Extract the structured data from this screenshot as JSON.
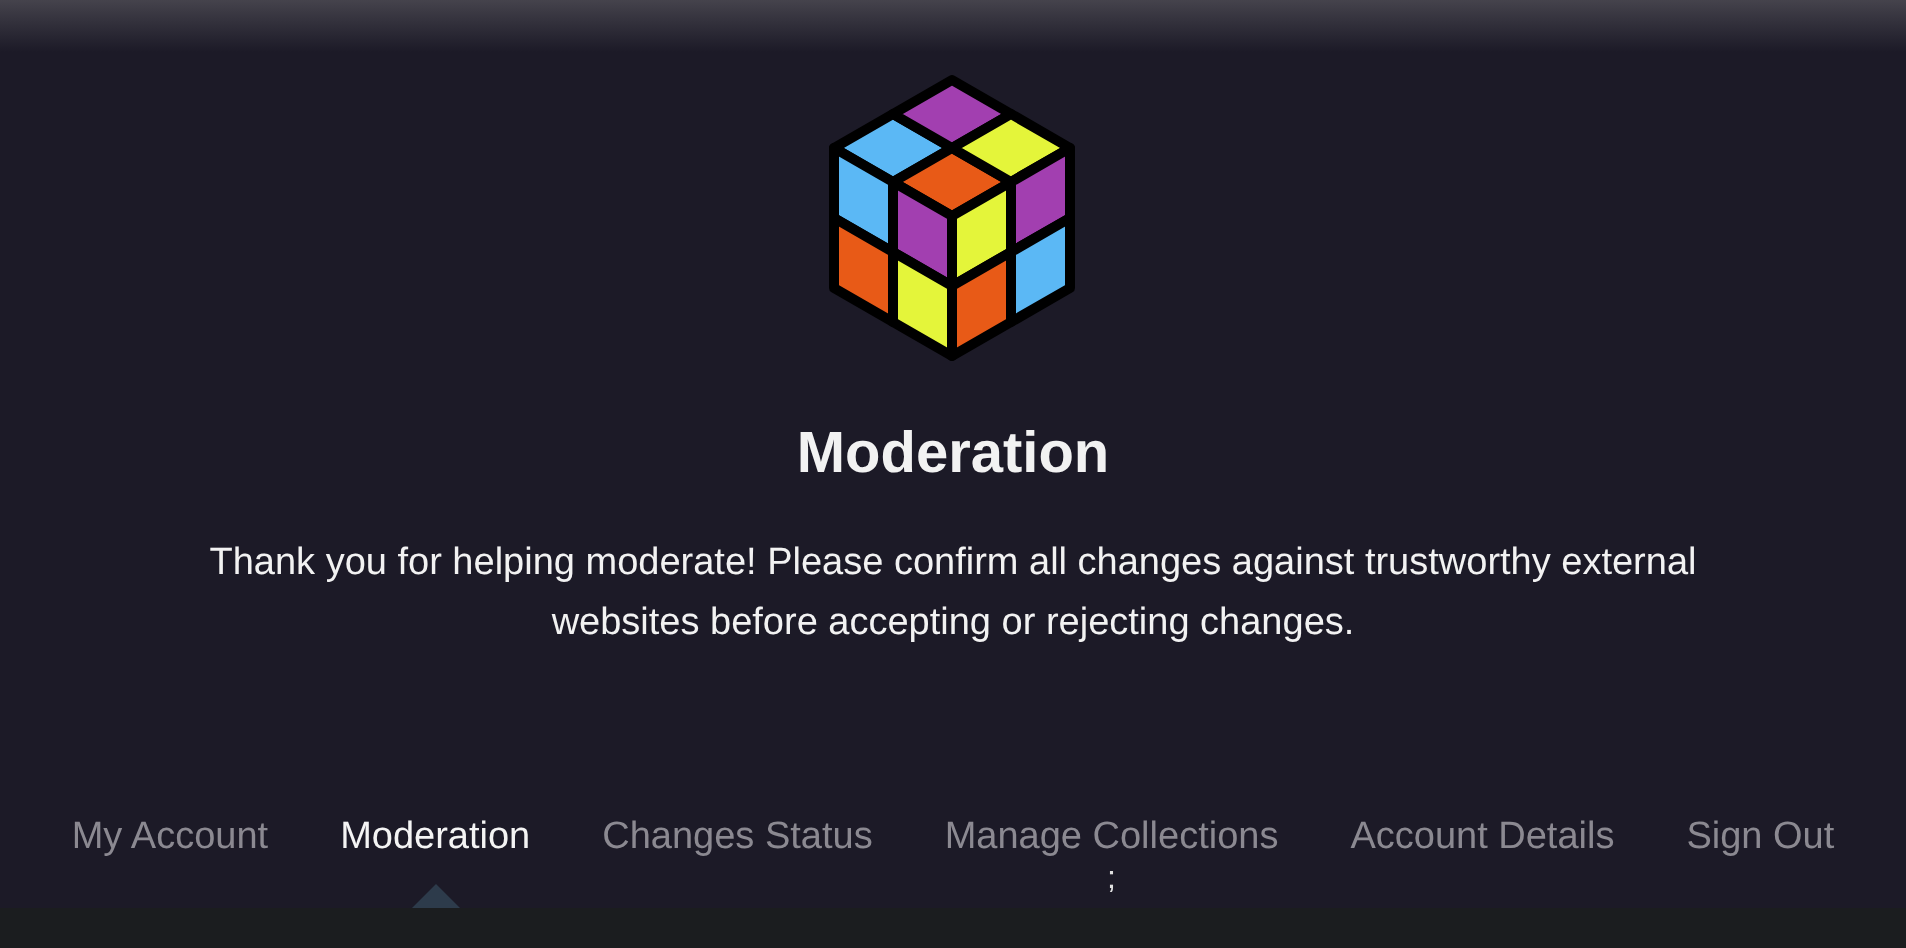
{
  "header": {
    "title": "Moderation",
    "message": "Thank you for helping moderate! Please confirm all changes against trustworthy external websites before accepting or rejecting changes."
  },
  "tabs": [
    {
      "label": "My Account",
      "selected": false
    },
    {
      "label": "Moderation",
      "selected": true
    },
    {
      "label": "Changes Status",
      "selected": false
    },
    {
      "label": "Manage Collections",
      "selected": false,
      "suffix": ";"
    },
    {
      "label": "Account Details",
      "selected": false
    },
    {
      "label": "Sign Out",
      "selected": false
    }
  ]
}
